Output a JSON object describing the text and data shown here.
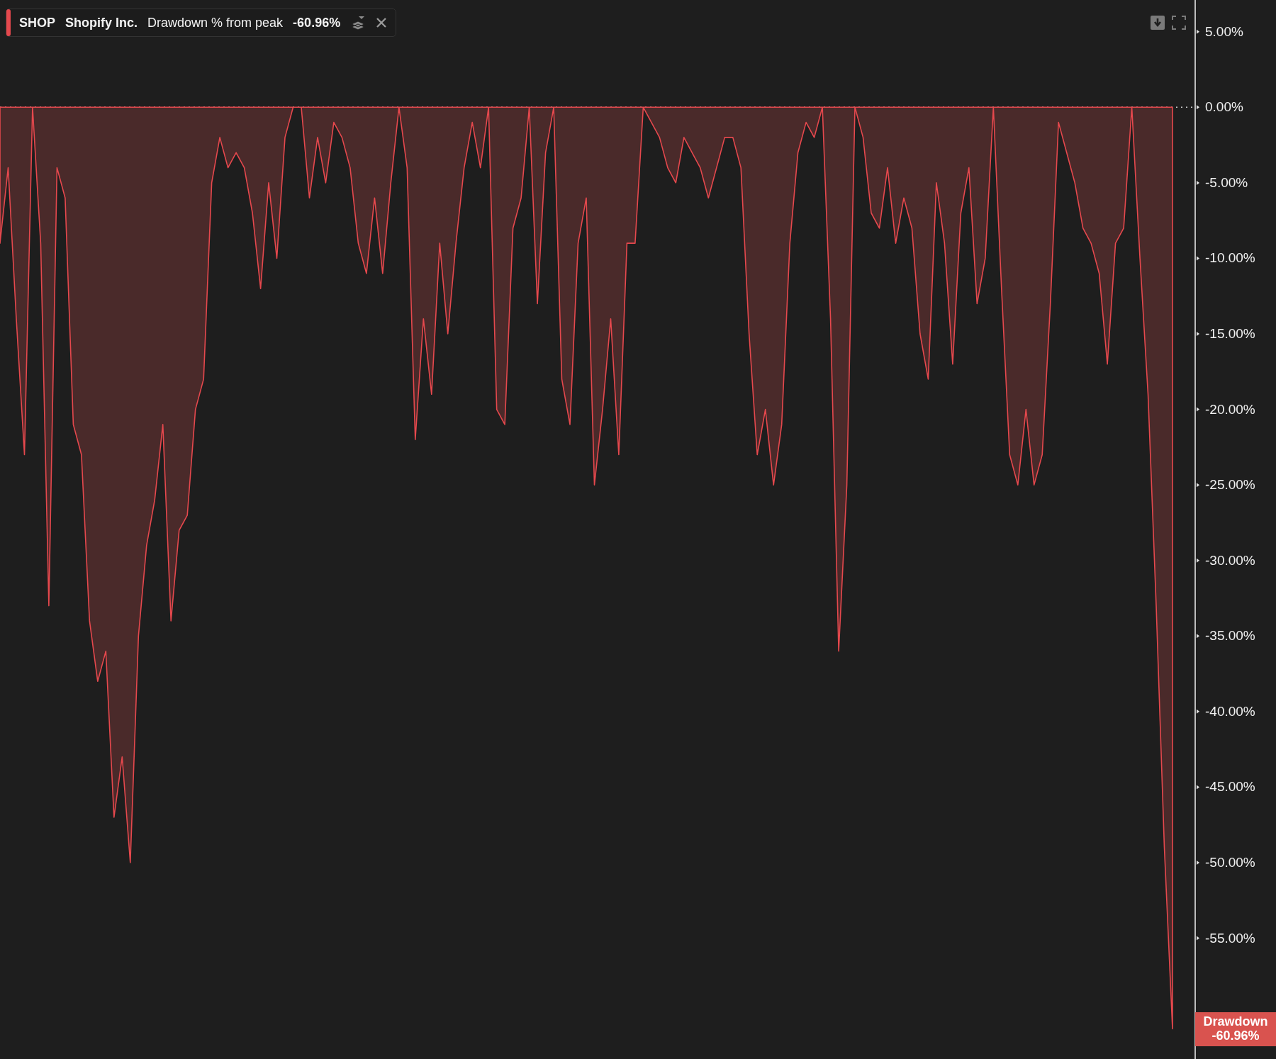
{
  "legend": {
    "symbol": "SHOP",
    "name": "Shopify Inc.",
    "metric": "Drawdown % from peak",
    "value": "-60.96%",
    "color": "#e5484d"
  },
  "chart_data": {
    "type": "area",
    "yticks": [
      {
        "value": 5,
        "label": "5.00%"
      },
      {
        "value": 0,
        "label": "0.00%"
      },
      {
        "value": -5,
        "label": "-5.00%"
      },
      {
        "value": -10,
        "label": "-10.00%"
      },
      {
        "value": -15,
        "label": "-15.00%"
      },
      {
        "value": -20,
        "label": "-20.00%"
      },
      {
        "value": -25,
        "label": "-25.00%"
      },
      {
        "value": -30,
        "label": "-30.00%"
      },
      {
        "value": -35,
        "label": "-35.00%"
      },
      {
        "value": -40,
        "label": "-40.00%"
      },
      {
        "value": -45,
        "label": "-45.00%"
      },
      {
        "value": -50,
        "label": "-50.00%"
      },
      {
        "value": -55,
        "label": "-55.00%"
      }
    ],
    "ylim": [
      -63,
      7.1
    ],
    "series": [
      {
        "name": "Drawdown",
        "color": "#e5484d",
        "values": [
          -9,
          -4,
          -14,
          -23,
          0,
          -9,
          -33,
          -4,
          -6,
          -21,
          -23,
          -34,
          -38,
          -36,
          -47,
          -43,
          -50,
          -35,
          -29,
          -26,
          -21,
          -34,
          -28,
          -27,
          -20,
          -18,
          -5,
          -2,
          -4,
          -3,
          -4,
          -7,
          -12,
          -5,
          -10,
          -2,
          0,
          0,
          -6,
          -2,
          -5,
          -1,
          -2,
          -4,
          -9,
          -11,
          -6,
          -11,
          -5,
          0,
          -4,
          -22,
          -14,
          -19,
          -9,
          -15,
          -9,
          -4,
          -1,
          -4,
          0,
          -20,
          -21,
          -8,
          -6,
          0,
          -13,
          -3,
          0,
          -18,
          -21,
          -9,
          -6,
          -25,
          -20,
          -14,
          -23,
          -9,
          -9,
          0,
          -1,
          -2,
          -4,
          -5,
          -2,
          -3,
          -4,
          -6,
          -4,
          -2,
          -2,
          -4,
          -15,
          -23,
          -20,
          -25,
          -21,
          -9,
          -3,
          -1,
          -2,
          0,
          -14,
          -36,
          -25,
          0,
          -2,
          -7,
          -8,
          -4,
          -9,
          -6,
          -8,
          -15,
          -18,
          -5,
          -9,
          -17,
          -7,
          -4,
          -13,
          -10,
          0,
          -12,
          -23,
          -25,
          -20,
          -25,
          -23,
          -13,
          -1,
          -3,
          -5,
          -8,
          -9,
          -11,
          -17,
          -9,
          -8,
          0,
          -10,
          -19,
          -33,
          -49,
          -61
        ]
      }
    ]
  },
  "badge": {
    "value": "-60.96%"
  }
}
